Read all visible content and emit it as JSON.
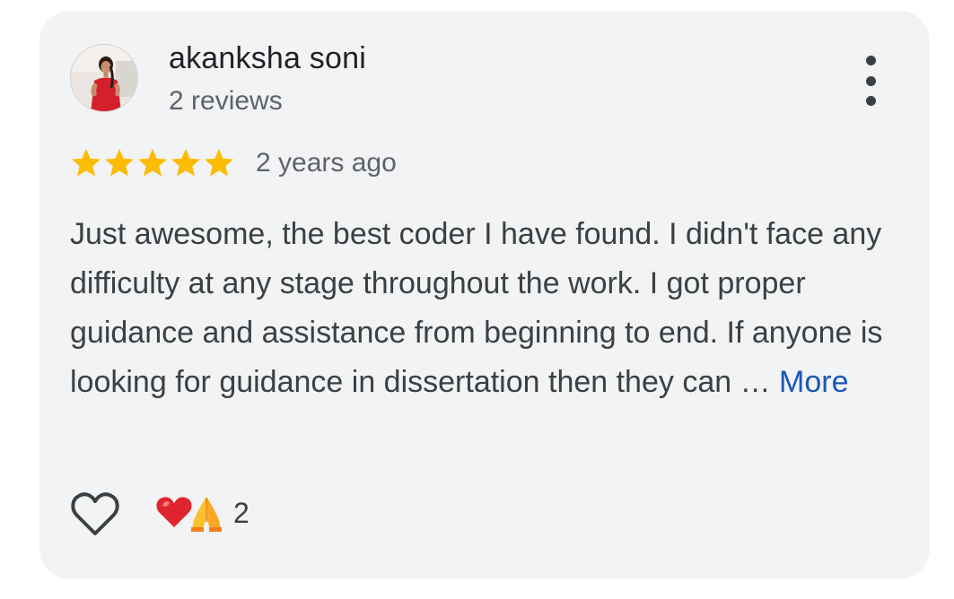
{
  "review": {
    "author_name": "akanksha soni",
    "author_reviews": "2 reviews",
    "rating": 5,
    "rating_max": 5,
    "time_ago": "2 years ago",
    "text": "Just awesome, the best coder I have found. I didn't face any difficulty at any stage throughout the work. I got proper guidance and assistance from beginning to end. If anyone is looking for guidance in dissertation then they can … ",
    "more_label": "More",
    "reactions": {
      "icons": [
        "heart-emoji",
        "folded-hands-emoji"
      ],
      "count": "2"
    }
  },
  "icons": {
    "star": "star-icon",
    "menu": "more-vert-icon",
    "like": "heart-outline-icon"
  },
  "colors": {
    "card_bg": "#f1f3f4",
    "star": "#fbbc04",
    "link": "#1a56b8",
    "text_primary": "#202124",
    "text_secondary": "#5f6368"
  }
}
